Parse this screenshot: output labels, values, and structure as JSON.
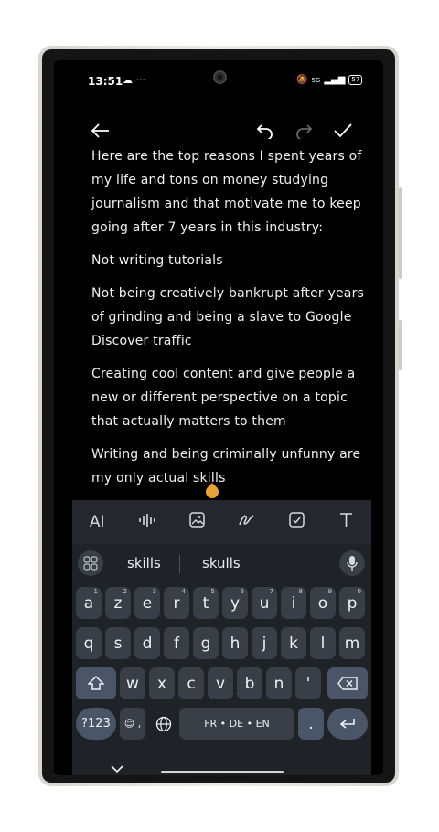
{
  "status": {
    "time": "13:51",
    "left_icons": "☁ ···",
    "network": "5G",
    "battery": "57"
  },
  "editor": {
    "paragraphs": [
      "Here are the top reasons I spent years of my life and tons on money studying journalism and that motivate me to keep going after 7 years in this industry:",
      "Not writing tutorials",
      "Not being creatively bankrupt after years of grinding and being a slave to Google Discover traffic",
      "Creating cool content and give people a new or different perspective on a topic that actually matters to them",
      "Writing and being criminally unfunny are my only actual skills"
    ]
  },
  "keyboard": {
    "tools": [
      "AI",
      "voice-icon",
      "image-icon",
      "handwriting-icon",
      "checklist-icon",
      "text-format-icon"
    ],
    "ai_label": "AI",
    "suggestions": [
      "skills",
      "skulls"
    ],
    "row1": [
      {
        "k": "a",
        "n": "1"
      },
      {
        "k": "z",
        "n": "2"
      },
      {
        "k": "e",
        "n": "3"
      },
      {
        "k": "r",
        "n": "4"
      },
      {
        "k": "t",
        "n": "5"
      },
      {
        "k": "y",
        "n": "6"
      },
      {
        "k": "u",
        "n": "7"
      },
      {
        "k": "i",
        "n": "8"
      },
      {
        "k": "o",
        "n": "9"
      },
      {
        "k": "p",
        "n": "0"
      }
    ],
    "row2": [
      "q",
      "s",
      "d",
      "f",
      "g",
      "h",
      "j",
      "k",
      "l",
      "m"
    ],
    "row3": [
      "w",
      "x",
      "c",
      "v",
      "b",
      "n",
      "'"
    ],
    "sym_label": "?123",
    "emoji_label": "☺ ,",
    "space_label": "FR • DE • EN",
    "period_label": "."
  }
}
